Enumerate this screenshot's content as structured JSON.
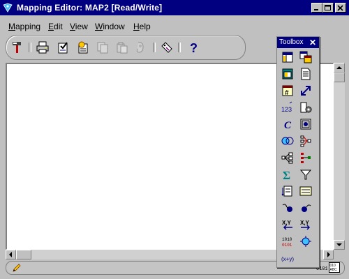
{
  "window": {
    "title": "Mapping Editor: MAP2 [Read/Write]",
    "controls": [
      "minimize",
      "maximize",
      "close"
    ]
  },
  "menu": {
    "items": [
      {
        "label": "Mapping"
      },
      {
        "label": "Edit"
      },
      {
        "label": "View"
      },
      {
        "label": "Window"
      },
      {
        "label": "Help"
      }
    ]
  },
  "toolbar": {
    "buttons": [
      {
        "icon": "hammer-icon",
        "enabled": true
      },
      {
        "icon": "print-icon",
        "enabled": true
      },
      {
        "icon": "properties-icon",
        "enabled": true
      },
      {
        "icon": "validate-icon",
        "enabled": true
      },
      {
        "icon": "copy-icon",
        "enabled": false
      },
      {
        "icon": "paste-icon",
        "enabled": false
      },
      {
        "icon": "expand-icon",
        "enabled": false
      },
      {
        "icon": "tag-icon",
        "enabled": true
      },
      {
        "icon": "help-icon",
        "enabled": true
      }
    ]
  },
  "toolbox": {
    "title": "Toolbox",
    "tools": [
      "table-icon",
      "table-multi-icon",
      "view-icon",
      "document-icon",
      "sequence-icon",
      "join-arrow-icon",
      "constant-icon",
      "procedure-icon",
      "expression-icon",
      "image-icon",
      "union-icon",
      "splitter-icon",
      "lookup-icon",
      "key-lookup-icon",
      "aggregator-icon",
      "filter-icon",
      "pivot-icon",
      "sorter-icon",
      "pre-mapping-icon",
      "post-mapping-icon",
      "input-param-icon",
      "output-param-icon",
      "binary-icon",
      "transform-icon",
      "formula-icon"
    ]
  },
  "status": {
    "icons": [
      "pencil-icon",
      "binary-icon",
      "abc-icon"
    ]
  },
  "colors": {
    "titlebar": "#000080",
    "face": "#c0c0c0",
    "canvas": "#ffffff"
  }
}
